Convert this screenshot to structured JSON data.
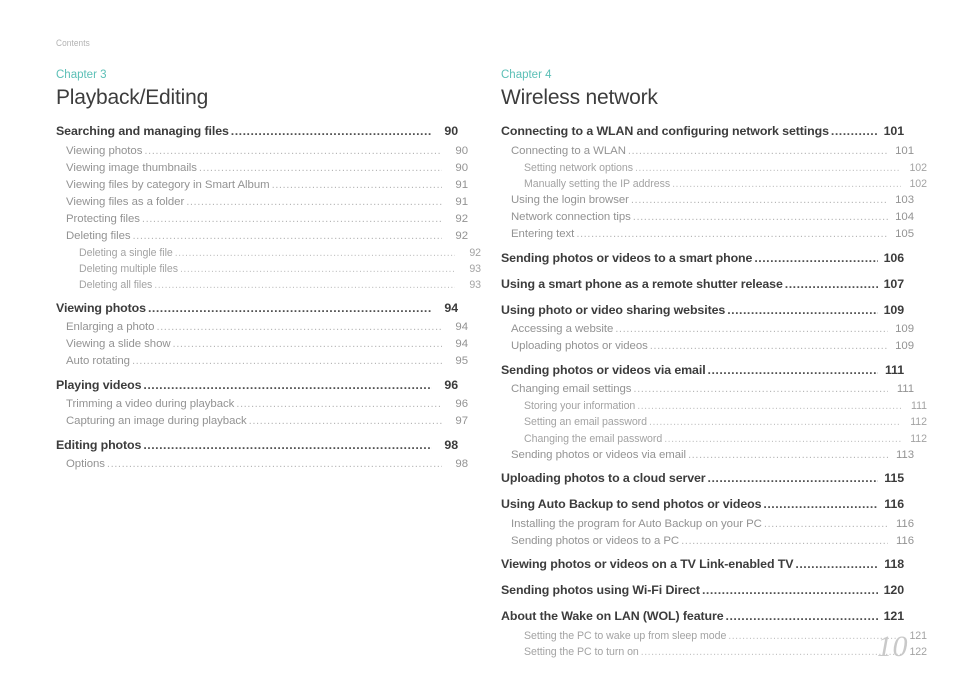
{
  "running_header": "Contents",
  "folio": "10",
  "accent_color": "#5bbfb6",
  "left_column": {
    "chapter_label": "Chapter 3",
    "chapter_title": "Playback/Editing",
    "entries": [
      {
        "level": 1,
        "label": "Searching and managing files",
        "page": "90"
      },
      {
        "level": 2,
        "label": "Viewing photos",
        "page": "90"
      },
      {
        "level": 2,
        "label": "Viewing image thumbnails",
        "page": "90"
      },
      {
        "level": 2,
        "label": "Viewing files by category in Smart Album",
        "page": "91"
      },
      {
        "level": 2,
        "label": "Viewing files as a folder",
        "page": "91"
      },
      {
        "level": 2,
        "label": "Protecting files",
        "page": "92"
      },
      {
        "level": 2,
        "label": "Deleting files",
        "page": "92"
      },
      {
        "level": 3,
        "label": "Deleting a single file",
        "page": "92"
      },
      {
        "level": 3,
        "label": "Deleting multiple files",
        "page": "93"
      },
      {
        "level": 3,
        "label": "Deleting all files",
        "page": "93"
      },
      {
        "level": 1,
        "label": "Viewing photos",
        "page": "94"
      },
      {
        "level": 2,
        "label": "Enlarging a photo",
        "page": "94"
      },
      {
        "level": 2,
        "label": "Viewing a slide show",
        "page": "94"
      },
      {
        "level": 2,
        "label": "Auto rotating",
        "page": "95"
      },
      {
        "level": 1,
        "label": "Playing videos",
        "page": "96"
      },
      {
        "level": 2,
        "label": "Trimming a video during playback",
        "page": "96"
      },
      {
        "level": 2,
        "label": "Capturing an image during playback",
        "page": "97"
      },
      {
        "level": 1,
        "label": "Editing photos",
        "page": "98"
      },
      {
        "level": 2,
        "label": "Options",
        "page": "98"
      }
    ]
  },
  "right_column": {
    "chapter_label": "Chapter 4",
    "chapter_title": "Wireless network",
    "entries": [
      {
        "level": 1,
        "label": "Connecting to a WLAN and configuring network settings",
        "page": "101"
      },
      {
        "level": 2,
        "label": "Connecting to a WLAN",
        "page": "101"
      },
      {
        "level": 3,
        "label": "Setting network options",
        "page": "102"
      },
      {
        "level": 3,
        "label": "Manually setting the IP address",
        "page": "102"
      },
      {
        "level": 2,
        "label": "Using the login browser",
        "page": "103"
      },
      {
        "level": 2,
        "label": "Network connection tips",
        "page": "104"
      },
      {
        "level": 2,
        "label": "Entering text",
        "page": "105"
      },
      {
        "level": 1,
        "label": "Sending photos or videos to a smart phone",
        "page": "106"
      },
      {
        "level": 1,
        "label": "Using a smart phone as a remote shutter release",
        "page": "107"
      },
      {
        "level": 1,
        "label": "Using photo or video sharing websites",
        "page": "109"
      },
      {
        "level": 2,
        "label": "Accessing a website",
        "page": "109"
      },
      {
        "level": 2,
        "label": "Uploading photos or videos",
        "page": "109"
      },
      {
        "level": 1,
        "label": "Sending photos or videos via email",
        "page": "111"
      },
      {
        "level": 2,
        "label": "Changing email settings",
        "page": "111"
      },
      {
        "level": 3,
        "label": "Storing your information",
        "page": "111"
      },
      {
        "level": 3,
        "label": "Setting an email password",
        "page": "112"
      },
      {
        "level": 3,
        "label": "Changing the email password",
        "page": "112"
      },
      {
        "level": 2,
        "label": "Sending photos or videos via email",
        "page": "113"
      },
      {
        "level": 1,
        "label": "Uploading photos to a cloud server",
        "page": "115"
      },
      {
        "level": 1,
        "label": "Using Auto Backup to send photos or videos",
        "page": "116"
      },
      {
        "level": 2,
        "label": "Installing the program for Auto Backup on your PC",
        "page": "116"
      },
      {
        "level": 2,
        "label": "Sending photos or videos to a PC",
        "page": "116"
      },
      {
        "level": 1,
        "label": "Viewing photos or videos on a TV Link-enabled TV",
        "page": "118"
      },
      {
        "level": 1,
        "label": "Sending photos using Wi-Fi Direct",
        "page": "120"
      },
      {
        "level": 1,
        "label": "About the Wake on LAN (WOL) feature",
        "page": "121"
      },
      {
        "level": 3,
        "label": "Setting the PC to wake up from sleep mode",
        "page": "121"
      },
      {
        "level": 3,
        "label": "Setting the PC to turn on",
        "page": "122"
      }
    ]
  }
}
